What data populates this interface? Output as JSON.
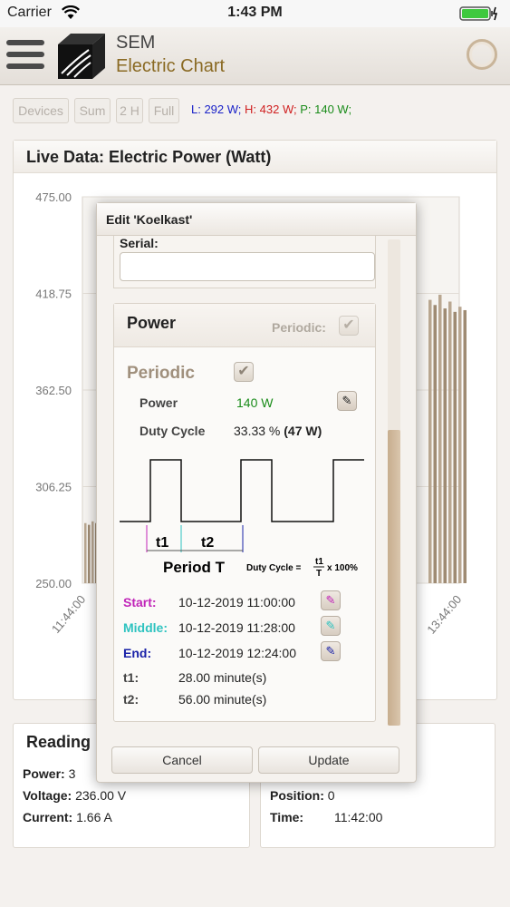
{
  "status_bar": {
    "carrier": "Carrier",
    "time": "1:43 PM"
  },
  "header": {
    "app_name": "SEM",
    "subtitle": "Electric Chart"
  },
  "toolbar": {
    "buttons": [
      "Devices",
      "Sum",
      "2 H",
      "Full"
    ],
    "readout": {
      "l": "L: 292 W;",
      "h": "H: 432 W;",
      "p": "P: 140 W;"
    }
  },
  "chart": {
    "title": "Live Data: Electric Power (Watt)"
  },
  "chart_data": {
    "type": "bar",
    "title": "Live Data: Electric Power (Watt)",
    "ylim": [
      250.0,
      475.0
    ],
    "yticks": [
      "475.00",
      "418.75",
      "362.50",
      "306.25",
      "250.00"
    ],
    "xticks": [
      "11:44:00",
      "13:44:00"
    ],
    "series": [
      {
        "values": [
          285,
          284,
          286,
          285,
          284,
          286,
          285,
          284
        ]
      },
      {
        "values": [
          415,
          412,
          418,
          410,
          414,
          408,
          411,
          409
        ]
      }
    ],
    "colors": {
      "bar": "#b9a791",
      "bar_dark": "#9f8b73"
    }
  },
  "readings": {
    "title": "Reading",
    "left": [
      {
        "label": "Power:",
        "value": "3"
      },
      {
        "label": "Voltage:",
        "value": "236.00 V"
      },
      {
        "label": "Current:",
        "value": "1.66 A"
      }
    ],
    "right": [
      {
        "label": "Position:",
        "value": "0"
      },
      {
        "label": "Time:",
        "value": "11:42:00"
      }
    ]
  },
  "modal": {
    "title": "Edit 'Koelkast'",
    "serial_label": "Serial:",
    "serial_value": "",
    "power": {
      "title": "Power",
      "periodic_small": "Periodic:",
      "periodic_big": "Periodic",
      "power_label": "Power",
      "power_value": "140 W",
      "duty_label": "Duty Cycle",
      "duty_value": "33.33 %",
      "duty_watt": "(47 W)",
      "diagram": {
        "t1": "t1",
        "t2": "t2",
        "period": "Period T",
        "formula_left": "Duty Cycle =",
        "formula_num": "t1",
        "formula_den": "T",
        "formula_right": "x 100%"
      },
      "start_label": "Start:",
      "start_value": "10-12-2019 11:00:00",
      "middle_label": "Middle:",
      "middle_value": "10-12-2019 11:28:00",
      "end_label": "End:",
      "end_value": "10-12-2019 12:24:00",
      "t1_label": "t1:",
      "t1_value": "28.00 minute(s)",
      "t2_label": "t2:",
      "t2_value": "56.00 minute(s)"
    },
    "cancel_label": "Cancel",
    "update_label": "Update"
  },
  "colors": {
    "start": "#c024b8",
    "middle": "#2ec3c0",
    "end": "#1a22a8",
    "power_value": "#1a8c1a"
  }
}
